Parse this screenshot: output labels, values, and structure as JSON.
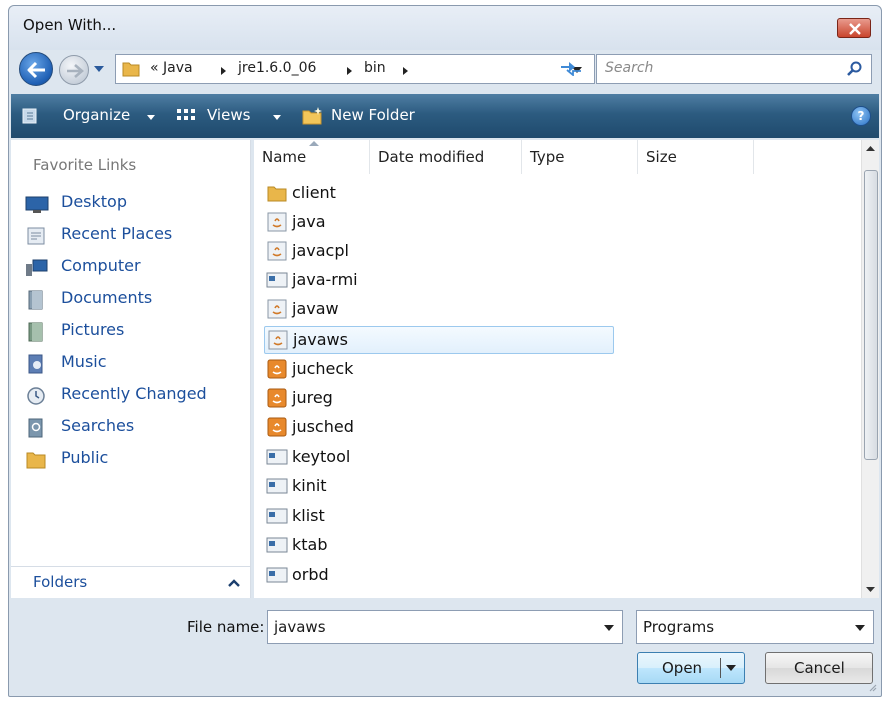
{
  "window": {
    "title": "Open With..."
  },
  "address": {
    "breadcrumbs": [
      {
        "label": "« Java"
      },
      {
        "label": "jre1.6.0_06"
      },
      {
        "label": "bin"
      }
    ],
    "search_placeholder": "Search"
  },
  "toolbar": {
    "organize_label": "Organize",
    "views_label": "Views",
    "new_folder_label": "New Folder"
  },
  "nav": {
    "header": "Favorite Links",
    "items": [
      {
        "label": "Desktop",
        "icon": "desktop-icon"
      },
      {
        "label": "Recent Places",
        "icon": "recent-places-icon"
      },
      {
        "label": "Computer",
        "icon": "computer-icon"
      },
      {
        "label": "Documents",
        "icon": "documents-icon"
      },
      {
        "label": "Pictures",
        "icon": "pictures-icon"
      },
      {
        "label": "Music",
        "icon": "music-icon"
      },
      {
        "label": "Recently Changed",
        "icon": "recently-changed-icon"
      },
      {
        "label": "Searches",
        "icon": "searches-icon"
      },
      {
        "label": "Public",
        "icon": "folder-icon"
      }
    ],
    "folders_label": "Folders"
  },
  "file_list": {
    "columns": [
      "Name",
      "Date modified",
      "Type",
      "Size"
    ],
    "files": [
      {
        "name": "client",
        "icon": "folder-icon"
      },
      {
        "name": "java",
        "icon": "java-app-icon"
      },
      {
        "name": "javacpl",
        "icon": "java-app-icon"
      },
      {
        "name": "java-rmi",
        "icon": "console-app-icon"
      },
      {
        "name": "javaw",
        "icon": "java-app-icon"
      },
      {
        "name": "javaws",
        "icon": "java-app-icon",
        "selected": true
      },
      {
        "name": "jucheck",
        "icon": "java-update-icon"
      },
      {
        "name": "jureg",
        "icon": "java-update-icon"
      },
      {
        "name": "jusched",
        "icon": "java-update-icon"
      },
      {
        "name": "keytool",
        "icon": "console-app-icon"
      },
      {
        "name": "kinit",
        "icon": "console-app-icon"
      },
      {
        "name": "klist",
        "icon": "console-app-icon"
      },
      {
        "name": "ktab",
        "icon": "console-app-icon"
      },
      {
        "name": "orbd",
        "icon": "console-app-icon"
      }
    ]
  },
  "bottom": {
    "file_name_label": "File name:",
    "file_name_value": "javaws",
    "file_type_value": "Programs",
    "open_label": "Open",
    "cancel_label": "Cancel"
  }
}
